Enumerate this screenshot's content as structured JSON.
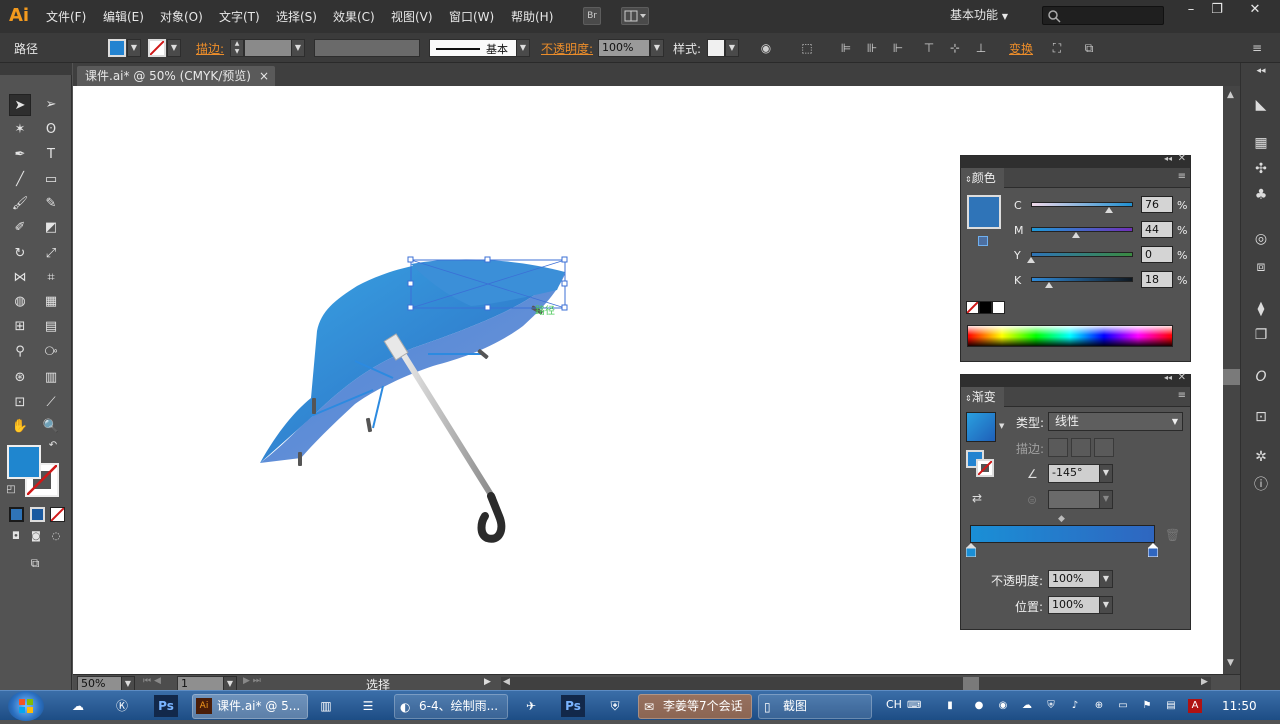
{
  "app": {
    "logo": "Ai",
    "workspace": "基本功能"
  },
  "menu": [
    "文件(F)",
    "编辑(E)",
    "对象(O)",
    "文字(T)",
    "选择(S)",
    "效果(C)",
    "视图(V)",
    "窗口(W)",
    "帮助(H)"
  ],
  "bridge_label": "Br",
  "control": {
    "object_type": "路径",
    "stroke_label": "描边:",
    "brush_label": "基本",
    "opacity_label": "不透明度:",
    "opacity_value": "100%",
    "style_label": "样式:",
    "transform_label": "变换"
  },
  "document": {
    "tab_title": "课件.ai* @ 50% (CMYK/预览)",
    "close_glyph": "×",
    "canvas_smart_guide": "路径"
  },
  "status": {
    "zoom": "50%",
    "artboard": "1",
    "tool_state": "选择"
  },
  "color_panel": {
    "title": "颜色",
    "channels": [
      {
        "name": "C",
        "value": "76",
        "fraction": 0.76
      },
      {
        "name": "M",
        "value": "44",
        "fraction": 0.44
      },
      {
        "name": "Y",
        "value": "0",
        "fraction": 0.0
      },
      {
        "name": "K",
        "value": "18",
        "fraction": 0.18
      }
    ],
    "percent_sign": "%",
    "fill_color": "#2f74b8"
  },
  "gradient_panel": {
    "title": "渐变",
    "type_label": "类型:",
    "type_value": "线性",
    "stroke_label": "描边:",
    "angle_value": "-145°",
    "opacity_label": "不透明度:",
    "opacity_value": "100%",
    "location_label": "位置:",
    "location_value": "100%"
  },
  "taskbar": {
    "buttons": [
      {
        "label": "课件.ai* @ 5..."
      },
      {
        "label": "6-4、绘制雨..."
      },
      {
        "label": "李姜等7个会话"
      },
      {
        "label": "截图"
      }
    ],
    "lang": "CH",
    "clock": "11:50"
  },
  "colors": {
    "accent_orange": "#ec8d2a",
    "umbrella_light": "#3a9fe0",
    "umbrella_dark": "#2f6fc2",
    "selection": "#3b6fd6"
  }
}
